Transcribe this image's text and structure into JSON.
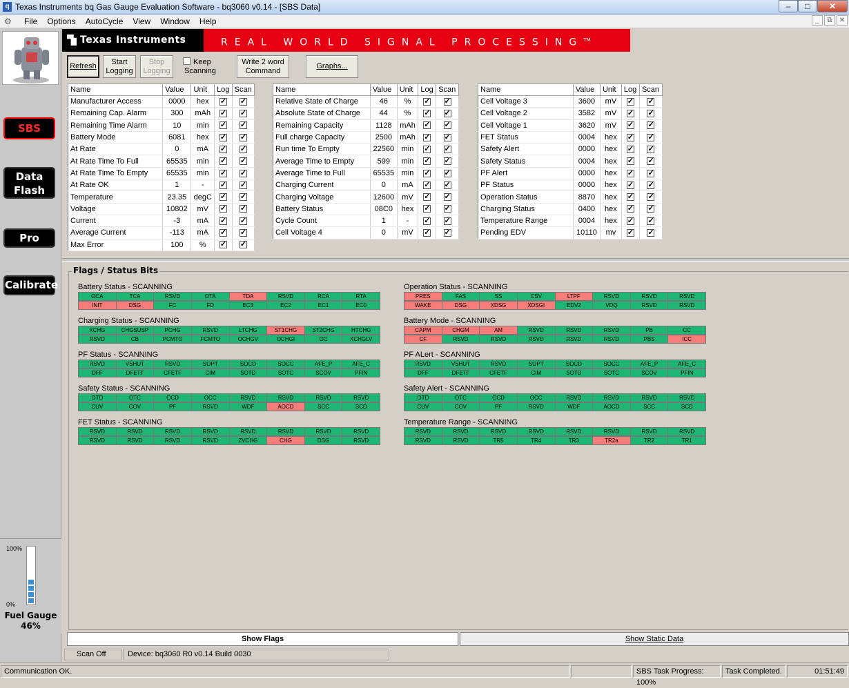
{
  "window": {
    "title": "Texas Instruments bq Gas Gauge Evaluation Software - bq3060 v0.14 - [SBS Data]"
  },
  "menu": [
    "File",
    "Options",
    "AutoCycle",
    "View",
    "Window",
    "Help"
  ],
  "nav": {
    "sbs": "SBS",
    "data_flash_1": "Data",
    "data_flash_2": "Flash",
    "pro": "Pro",
    "calibrate": "Calibrate"
  },
  "gauge": {
    "top": "100%",
    "bottom": "0%",
    "name": "Fuel Gauge",
    "percent": "46%",
    "level": 0.46
  },
  "banner": {
    "company": "Texas Instruments",
    "tagline": "REAL WORLD SIGNAL PROCESSING",
    "tm": "TM"
  },
  "toolbar": {
    "refresh": "Refresh",
    "start1": "Start",
    "start2": "Logging",
    "stop1": "Stop",
    "stop2": "Logging",
    "keep1": "Keep",
    "keep2": "Scanning",
    "write1": "Write 2 word",
    "write2": "Command",
    "graphs": "Graphs..."
  },
  "table_headers": {
    "name": "Name",
    "value": "Value",
    "unit": "Unit",
    "log": "Log",
    "scan": "Scan"
  },
  "tables": [
    [
      {
        "name": "Manufacturer Access",
        "value": "0000",
        "unit": "hex"
      },
      {
        "name": "Remaining Cap. Alarm",
        "value": "300",
        "unit": "mAh"
      },
      {
        "name": "Remaining Time Alarm",
        "value": "10",
        "unit": "min"
      },
      {
        "name": "Battery Mode",
        "value": "6081",
        "unit": "hex"
      },
      {
        "name": "At Rate",
        "value": "0",
        "unit": "mA"
      },
      {
        "name": "At Rate Time To Full",
        "value": "65535",
        "unit": "min"
      },
      {
        "name": "At Rate Time To Empty",
        "value": "65535",
        "unit": "min"
      },
      {
        "name": "At Rate OK",
        "value": "1",
        "unit": "-"
      },
      {
        "name": "Temperature",
        "value": "23.35",
        "unit": "degC"
      },
      {
        "name": "Voltage",
        "value": "10802",
        "unit": "mV"
      },
      {
        "name": "Current",
        "value": "-3",
        "unit": "mA"
      },
      {
        "name": "Average Current",
        "value": "-113",
        "unit": "mA"
      },
      {
        "name": "Max Error",
        "value": "100",
        "unit": "%"
      }
    ],
    [
      {
        "name": "Relative State of Charge",
        "value": "46",
        "unit": "%"
      },
      {
        "name": "Absolute State of Charge",
        "value": "44",
        "unit": "%"
      },
      {
        "name": "Remaining Capacity",
        "value": "1128",
        "unit": "mAh"
      },
      {
        "name": "Full charge Capacity",
        "value": "2500",
        "unit": "mAh"
      },
      {
        "name": "Run time To Empty",
        "value": "22560",
        "unit": "min"
      },
      {
        "name": "Average Time to Empty",
        "value": "599",
        "unit": "min"
      },
      {
        "name": "Average Time to Full",
        "value": "65535",
        "unit": "min"
      },
      {
        "name": "Charging Current",
        "value": "0",
        "unit": "mA"
      },
      {
        "name": "Charging Voltage",
        "value": "12600",
        "unit": "mV"
      },
      {
        "name": "Battery Status",
        "value": "08C0",
        "unit": "hex"
      },
      {
        "name": "Cycle Count",
        "value": "1",
        "unit": "-"
      },
      {
        "name": "Cell Voltage 4",
        "value": "0",
        "unit": "mV"
      }
    ],
    [
      {
        "name": "Cell Voltage 3",
        "value": "3600",
        "unit": "mV"
      },
      {
        "name": "Cell Voltage 2",
        "value": "3582",
        "unit": "mV"
      },
      {
        "name": "Cell Voltage 1",
        "value": "3620",
        "unit": "mV"
      },
      {
        "name": "FET Status",
        "value": "0004",
        "unit": "hex"
      },
      {
        "name": "Safety Alert",
        "value": "0000",
        "unit": "hex"
      },
      {
        "name": "Safety Status",
        "value": "0004",
        "unit": "hex"
      },
      {
        "name": "PF Alert",
        "value": "0000",
        "unit": "hex"
      },
      {
        "name": "PF Status",
        "value": "0000",
        "unit": "hex"
      },
      {
        "name": "Operation Status",
        "value": "8870",
        "unit": "hex"
      },
      {
        "name": "Charging Status",
        "value": "0400",
        "unit": "hex"
      },
      {
        "name": "Temperature Range",
        "value": "0004",
        "unit": "hex"
      },
      {
        "name": "Pending EDV",
        "value": "10110",
        "unit": "mv"
      }
    ]
  ],
  "flags_title": "Flags / Status Bits",
  "flag_groups": [
    {
      "title": "Battery Status - SCANNING",
      "rows": [
        [
          "OCA",
          "TCA",
          "RSVD",
          "OTA",
          "TDA",
          "RSVD",
          "RCA",
          "RTA"
        ],
        [
          "INIT",
          "DSG",
          "FC",
          "FD",
          "EC3",
          "EC2",
          "EC1",
          "EC0"
        ]
      ],
      "red": [
        [
          4
        ],
        [
          0,
          1
        ]
      ]
    },
    {
      "title": "Operation Status - SCANNING",
      "rows": [
        [
          "PRES",
          "FAS",
          "SS",
          "CSV",
          "LTPF",
          "RSVD",
          "RSVD",
          "RSVD"
        ],
        [
          "WAKE",
          "DSG",
          "XDSG",
          "XDSGI",
          "EDV2",
          "VDQ",
          "RSVD",
          "RSVD"
        ]
      ],
      "red": [
        [
          0,
          4
        ],
        [
          0,
          1,
          2,
          3
        ]
      ]
    },
    {
      "title": "Charging Status - SCANNING",
      "rows": [
        [
          "XCHG",
          "CHGSUSP",
          "PCHG",
          "RSVD",
          "LTCHG",
          "ST1CHG",
          "ST2CHG",
          "HTCHG"
        ],
        [
          "RSVD",
          "CB",
          "PCMTO",
          "FCMTO",
          "OCHGV",
          "OCHGI",
          "OC",
          "XCHGLV"
        ]
      ],
      "red": [
        [
          5
        ],
        []
      ]
    },
    {
      "title": "Battery Mode - SCANNING",
      "rows": [
        [
          "CAPM",
          "CHGM",
          "AM",
          "RSVD",
          "RSVD",
          "RSVD",
          "PB",
          "CC"
        ],
        [
          "CF",
          "RSVD",
          "RSVD",
          "RSVD",
          "RSVD",
          "RSVD",
          "PBS",
          "ICC"
        ]
      ],
      "red": [
        [
          0,
          1,
          2
        ],
        [
          0,
          7
        ]
      ]
    },
    {
      "title": "PF Status - SCANNING",
      "rows": [
        [
          "RSVD",
          "VSHUT",
          "RSVD",
          "SOPT",
          "SOCD",
          "SOCC",
          "AFE_P",
          "AFE_C"
        ],
        [
          "DFF",
          "DFETF",
          "CFETF",
          "CIM",
          "SOTD",
          "SOTC",
          "SCOV",
          "PFIN"
        ]
      ],
      "red": [
        [],
        []
      ]
    },
    {
      "title": "PF ALert - SCANNING",
      "rows": [
        [
          "RSVD",
          "VSHUT",
          "RSVD",
          "SOPT",
          "SOCD",
          "SOCC",
          "AFE_P",
          "AFE_C"
        ],
        [
          "DFF",
          "DFETF",
          "CFETF",
          "CIM",
          "SOTD",
          "SOTC",
          "SCOV",
          "PFIN"
        ]
      ],
      "red": [
        [],
        []
      ]
    },
    {
      "title": "Safety Status - SCANNING",
      "rows": [
        [
          "OTD",
          "OTC",
          "OCD",
          "OCC",
          "RSVD",
          "RSVD",
          "RSVD",
          "RSVD"
        ],
        [
          "CUV",
          "COV",
          "PF",
          "RSVD",
          "WDF",
          "AOCD",
          "SCC",
          "SCD"
        ]
      ],
      "red": [
        [],
        [
          5
        ]
      ]
    },
    {
      "title": "Safety Alert - SCANNING",
      "rows": [
        [
          "OTD",
          "OTC",
          "OCD",
          "OCC",
          "RSVD",
          "RSVD",
          "RSVD",
          "RSVD"
        ],
        [
          "CUV",
          "COV",
          "PF",
          "RSVD",
          "WDF",
          "AOCD",
          "SCC",
          "SCD"
        ]
      ],
      "red": [
        [],
        []
      ]
    },
    {
      "title": "FET Status - SCANNING",
      "rows": [
        [
          "RSVD",
          "RSVD",
          "RSVD",
          "RSVD",
          "RSVD",
          "RSVD",
          "RSVD",
          "RSVD"
        ],
        [
          "RSVD",
          "RSVD",
          "RSVD",
          "RSVD",
          "ZVCHG",
          "CHG",
          "DSG",
          "RSVD"
        ]
      ],
      "red": [
        [],
        [
          5
        ]
      ]
    },
    {
      "title": "Temperature Range - SCANNING",
      "rows": [
        [
          "RSVD",
          "RSVD",
          "RSVD",
          "RSVD",
          "RSVD",
          "RSVD",
          "RSVD",
          "RSVD"
        ],
        [
          "RSVD",
          "RSVD",
          "TR5",
          "TR4",
          "TR3",
          "TR2a",
          "TR2",
          "TR1"
        ]
      ],
      "red": [
        [],
        [
          5
        ]
      ]
    }
  ],
  "tabs": {
    "show_flags": "Show Flags",
    "show_static": "Show Static Data"
  },
  "status": {
    "scan": "Scan Off",
    "device": "Device: bq3060 R0 v0.14 Build 0030"
  },
  "bottom": {
    "comm": "Communication OK.",
    "progress": "SBS Task Progress: 100%",
    "task": "Task Completed.",
    "time": "01:51:49"
  },
  "colors": {
    "ok": "#1fb574",
    "set": "#f47d7a",
    "banner": "#e60012"
  }
}
